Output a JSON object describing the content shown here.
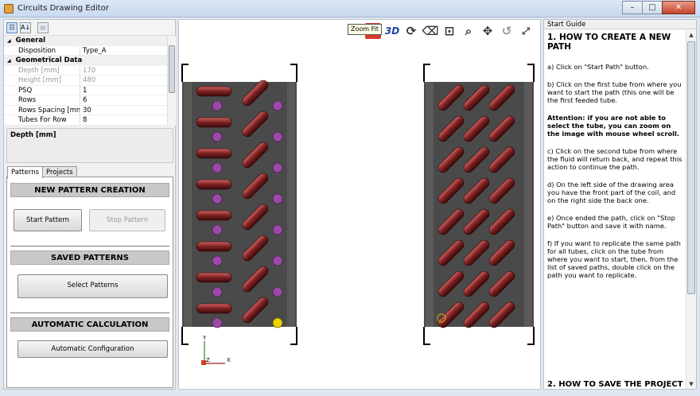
{
  "window": {
    "title": "Circuits Drawing Editor",
    "min": "–",
    "max": "□",
    "close": "✕"
  },
  "property_grid": {
    "toolbar": {
      "categorized": "☷",
      "alphabetical": "A↓",
      "pages": "▤"
    },
    "rows": [
      {
        "type": "cat",
        "label": "General",
        "glyph": "◢"
      },
      {
        "type": "prop",
        "key": "Disposition",
        "value": "Type_A"
      },
      {
        "type": "cat",
        "label": "Geometrical Data",
        "glyph": "◢"
      },
      {
        "type": "prop",
        "key": "Depth [mm]",
        "value": "170",
        "grey": true
      },
      {
        "type": "prop",
        "key": "Height [mm]",
        "value": "480",
        "grey": true
      },
      {
        "type": "prop",
        "key": "PSQ",
        "value": "1"
      },
      {
        "type": "prop",
        "key": "Rows",
        "value": "6"
      },
      {
        "type": "prop",
        "key": "Rows Spacing [mm]",
        "value": "30"
      },
      {
        "type": "prop",
        "key": "Tubes For Row",
        "value": "8"
      }
    ],
    "description": "Depth [mm]"
  },
  "tabs": [
    {
      "label": "Patterns",
      "active": true
    },
    {
      "label": "Projects",
      "active": false
    }
  ],
  "sections": {
    "new_pattern": {
      "header": "NEW PATTERN CREATION",
      "start": "Start Pattern",
      "stop": "Stop Pattern"
    },
    "saved": {
      "header": "SAVED PATTERNS",
      "select": "Select Patterns"
    },
    "auto": {
      "header": "AUTOMATIC CALCULATION",
      "config": "Automatic Configuration"
    }
  },
  "toolbar": {
    "view2d": "2D",
    "view3d": "3D",
    "tooltip": "Zoom Fit",
    "icons": [
      "rotate-icon",
      "eraser-icon",
      "zoom-area-icon",
      "zoom-icon",
      "pan-icon",
      "undo-icon",
      "zoom-fit-icon"
    ]
  },
  "axes": {
    "y": "Y",
    "z": "Z",
    "x": "X"
  },
  "colors": {
    "tube": "#7a2020",
    "tube_hi": "#d06060",
    "tube_circle": "#9a4aa6",
    "selected": "#e8d200",
    "coil_bg": "#4a4a4a"
  },
  "guide": {
    "header": "Start Guide",
    "title": "1. HOW TO CREATE A NEW PATH",
    "steps": [
      "a) Click on \"Start Path\" button.",
      "b) Click on the first tube from where you want to start the path (this one will be the first feeded tube.",
      "Attention: if you are not able to select the tube, you can zoom on the image with mouse wheel scroll.",
      "c) Click on the second tube from where the fluid will return back, and repeat this action to continue the path.",
      "d) On the left side of the drawing area you have the front part of the coil, and on the right side the back one.",
      "e) Once ended the path, click on \"Stop Path\" button and save it with name.",
      "f) If you want to replicate the same path for all tubes, click on the tube from where you want to start, then, from the list of saved paths, double click on the path you want to replicate."
    ],
    "next_title": "2. HOW TO SAVE THE PROJECT"
  }
}
